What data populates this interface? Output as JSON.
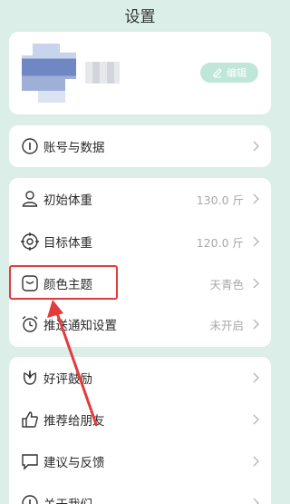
{
  "header": {
    "title": "设置"
  },
  "profile": {
    "edit_label": "编辑"
  },
  "account": {
    "label": "账号与数据"
  },
  "body_settings": [
    {
      "label": "初始体重",
      "value": "130.0 斤"
    },
    {
      "label": "目标体重",
      "value": "120.0 斤"
    },
    {
      "label": "颜色主题",
      "value": "天青色"
    },
    {
      "label": "推送通知设置",
      "value": "未开启"
    }
  ],
  "more": [
    {
      "label": "好评鼓励"
    },
    {
      "label": "推荐给朋友"
    },
    {
      "label": "建议与反馈"
    },
    {
      "label": "关于我们"
    }
  ],
  "annotation": {
    "color": "#e53a3a"
  },
  "theme": {
    "accent": "#bfe6d9",
    "background": "#dbeee7"
  }
}
